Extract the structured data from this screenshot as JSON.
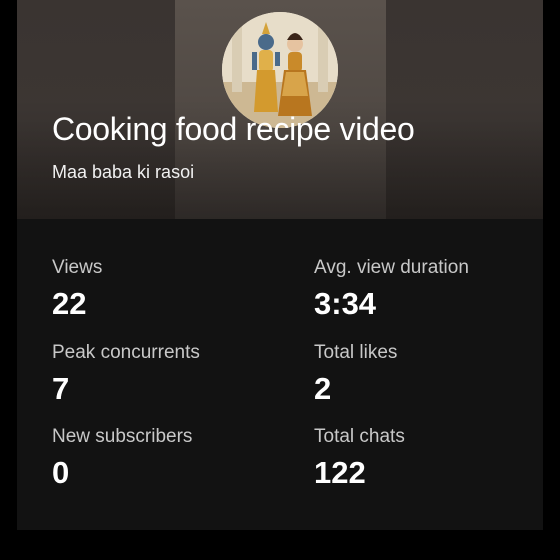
{
  "header": {
    "title": "Cooking food recipe video",
    "channel": "Maa baba ki rasoi",
    "avatar_icon": "channel-avatar-image"
  },
  "stats": [
    {
      "label": "Views",
      "value": "22"
    },
    {
      "label": "Avg. view duration",
      "value": "3:34"
    },
    {
      "label": "Peak concurrents",
      "value": "7"
    },
    {
      "label": "Total likes",
      "value": "2"
    },
    {
      "label": "New subscribers",
      "value": "0"
    },
    {
      "label": "Total chats",
      "value": "122"
    }
  ],
  "colors": {
    "background": "#000000",
    "card": "#121212",
    "hero": "#3c3633",
    "label": "#c8c8c8",
    "value": "#ffffff"
  }
}
